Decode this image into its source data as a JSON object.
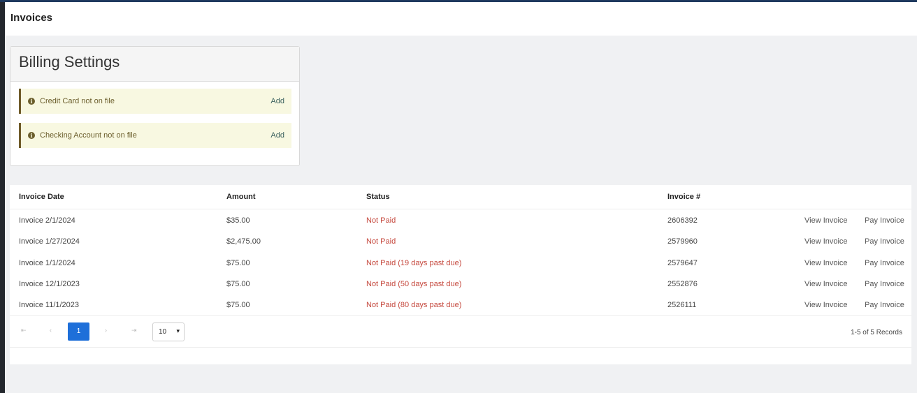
{
  "page": {
    "title": "Invoices"
  },
  "billing": {
    "title": "Billing Settings",
    "alerts": [
      {
        "text": "Credit Card not on file",
        "action": "Add"
      },
      {
        "text": "Checking Account not on file",
        "action": "Add"
      }
    ],
    "info_icon": "info-icon"
  },
  "table": {
    "headers": [
      "Invoice Date",
      "Amount",
      "Status",
      "Invoice #"
    ],
    "rows": [
      {
        "date": "Invoice 2/1/2024",
        "amount": "$35.00",
        "status": "Not Paid",
        "number": "2606392",
        "view": "View Invoice",
        "pay": "Pay Invoice"
      },
      {
        "date": "Invoice 1/27/2024",
        "amount": "$2,475.00",
        "status": "Not Paid",
        "number": "2579960",
        "view": "View Invoice",
        "pay": "Pay Invoice"
      },
      {
        "date": "Invoice 1/1/2024",
        "amount": "$75.00",
        "status": "Not Paid (19 days past due)",
        "number": "2579647",
        "view": "View Invoice",
        "pay": "Pay Invoice"
      },
      {
        "date": "Invoice 12/1/2023",
        "amount": "$75.00",
        "status": "Not Paid (50 days past due)",
        "number": "2552876",
        "view": "View Invoice",
        "pay": "Pay Invoice"
      },
      {
        "date": "Invoice 11/1/2023",
        "amount": "$75.00",
        "status": "Not Paid (80 days past due)",
        "number": "2526111",
        "view": "View Invoice",
        "pay": "Pay Invoice"
      }
    ]
  },
  "pagination": {
    "first": "⇤",
    "prev": "‹",
    "current": "1",
    "next": "›",
    "last": "⇥",
    "page_size": "10",
    "records": "1-5 of 5 Records"
  },
  "colors": {
    "status_unpaid": "#c5483d",
    "pager_active": "#1e6fd9",
    "alert_bg": "#f8f8e1"
  }
}
